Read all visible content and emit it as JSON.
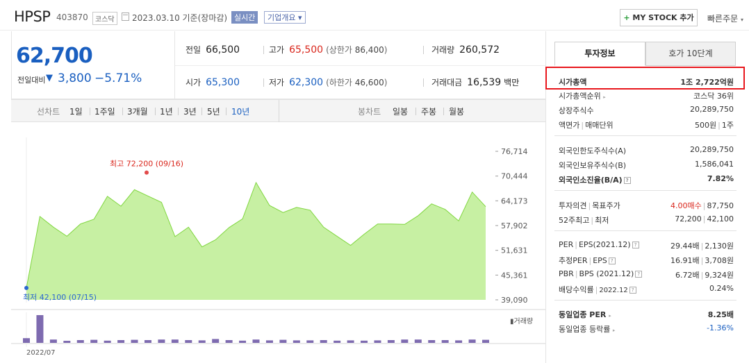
{
  "header": {
    "stock_name": "HPSP",
    "stock_code": "403870",
    "market": "코스닥",
    "date_text": "2023.03.10  기준(장마감)",
    "realtime_label": "실시간",
    "overview_label": "기업개요 ▾",
    "mystock_plus": "+",
    "mystock_label": " MY STOCK 추가",
    "quick_order_label": "빠른주문 ",
    "quick_order_caret": "▾"
  },
  "price": {
    "current": "62,700",
    "change_label": "전일대비",
    "change_arrow": "▼",
    "change_value": "3,800",
    "change_pct": "−5.71%"
  },
  "quote": {
    "prev_close_label": "전일",
    "prev_close": "66,500",
    "high_label": "고가",
    "high": "65,500",
    "upper_limit_label": "(상한가 ",
    "upper_limit": "86,400",
    "upper_close": ")",
    "volume_label": "거래량",
    "volume": "260,572",
    "open_label": "시가",
    "open": "65,300",
    "low_label": "저가",
    "low": "62,300",
    "lower_limit_label": "(하한가 ",
    "lower_limit": "46,600",
    "lower_close": ")",
    "amount_label": "거래대금",
    "amount": "16,539",
    "amount_unit": "백만"
  },
  "chart_bar": {
    "line_label": "선차트",
    "periods": [
      "1일",
      "1주일",
      "3개월",
      "1년",
      "3년",
      "5년",
      "10년"
    ],
    "active_period": "10년",
    "candle_label": "봉차트",
    "candle_periods": [
      "일봉",
      "주봉",
      "월봉"
    ]
  },
  "chart_data": {
    "type": "area",
    "y_ticks": [
      "76,714",
      "70,444",
      "64,173",
      "57,902",
      "51,631",
      "45,361",
      "39,090"
    ],
    "ylim": [
      39090,
      76714
    ],
    "x_ticks": [
      "2022/07"
    ],
    "values": [
      42100,
      60200,
      57500,
      55200,
      58300,
      59500,
      65300,
      62800,
      67000,
      65400,
      63800,
      55100,
      57500,
      52500,
      54300,
      57400,
      59600,
      68800,
      63000,
      61200,
      62500,
      61800,
      57500,
      55200,
      52900,
      55700,
      58300,
      58300,
      58200,
      60400,
      63400,
      62000,
      59100,
      66400,
      62700
    ],
    "high_label": "최고 72,200 (09/16)",
    "low_label": "최저 42,100 (07/15)",
    "volume_legend": "▮거래량",
    "volumes": [
      0.17,
      1.0,
      0.12,
      0.07,
      0.1,
      0.11,
      0.08,
      0.1,
      0.11,
      0.1,
      0.12,
      0.12,
      0.1,
      0.09,
      0.14,
      0.1,
      0.08,
      0.12,
      0.09,
      0.11,
      0.09,
      0.09,
      0.1,
      0.08,
      0.09,
      0.08,
      0.09,
      0.1,
      0.12,
      0.12,
      0.1,
      0.1,
      0.09,
      0.12,
      0.11
    ],
    "area_color": "#c7f0a3",
    "line_color": "#7fd63e",
    "volume_color": "#7e6bb0"
  },
  "panel": {
    "tab_invest": "투자정보",
    "tab_orderbook": "호가 10단계",
    "rows1": [
      {
        "label": "시가총액",
        "value": "1조 2,722억원"
      },
      {
        "label": "시가총액순위",
        "value": "코스닥 36위"
      },
      {
        "label": "상장주식수",
        "value": "20,289,750"
      },
      {
        "label": "액면가",
        "label2": "매매단위",
        "value": "500원",
        "value2": "1주"
      }
    ],
    "rows2": [
      {
        "label": "외국인한도주식수(A)",
        "value": "20,289,750"
      },
      {
        "label": "외국인보유주식수(B)",
        "value": "1,586,041"
      },
      {
        "label": "외국인소진율(B/A)",
        "value": "7.82%"
      }
    ],
    "rows3": [
      {
        "label": "투자의견",
        "label2": "목표주가",
        "value": "4.00매수",
        "value2": "87,750"
      },
      {
        "label": "52주최고",
        "label2": "최저",
        "value": "72,200",
        "value2": "42,100"
      }
    ],
    "rows4": [
      {
        "label": "PER",
        "label2": "EPS(2021.12)",
        "value": "29.44배",
        "value2": "2,130원"
      },
      {
        "label": "추정PER",
        "label2": "EPS",
        "value": "16.91배",
        "value2": "3,708원"
      },
      {
        "label": "PBR",
        "label2": "BPS (2021.12)",
        "value": "6.72배",
        "value2": "9,324원"
      },
      {
        "label": "배당수익률",
        "label2": "2022.12",
        "value": "0.24%"
      }
    ],
    "rows5": [
      {
        "label": "동일업종 PER",
        "value": "8.25배"
      },
      {
        "label": "동일업종 등락률",
        "value": "-1.36%"
      }
    ],
    "tri": "▸",
    "qmark": "?",
    "sep": "|"
  }
}
